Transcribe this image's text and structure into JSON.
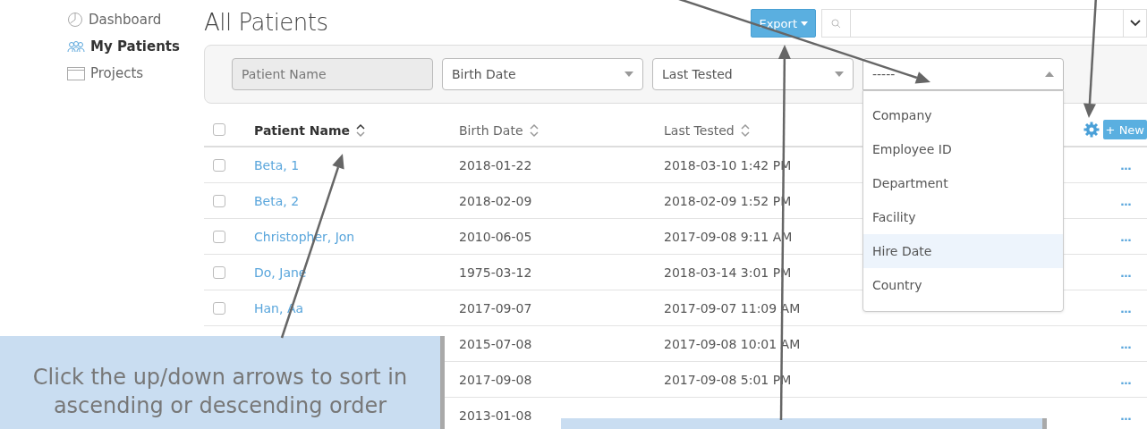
{
  "sidebar": {
    "items": [
      {
        "label": "Dashboard",
        "selected": false
      },
      {
        "label": "My Patients",
        "selected": true
      },
      {
        "label": "Projects",
        "selected": false
      }
    ]
  },
  "page_title": "All Patients",
  "export_button": {
    "label": "Export"
  },
  "filters": [
    {
      "label": "Patient Name",
      "kind": "text",
      "disabled": true
    },
    {
      "label": "Birth Date",
      "kind": "select",
      "expanded": false
    },
    {
      "label": "Last Tested",
      "kind": "select",
      "expanded": false
    },
    {
      "label": "-----",
      "kind": "select",
      "expanded": true,
      "options": [
        {
          "label": "Company",
          "selected": false
        },
        {
          "label": "Employee ID",
          "selected": false
        },
        {
          "label": "Department",
          "selected": false
        },
        {
          "label": "Facility",
          "selected": false
        },
        {
          "label": "Hire Date",
          "selected": true
        },
        {
          "label": "Country",
          "selected": false
        }
      ]
    }
  ],
  "table": {
    "select_all": {
      "checked": false
    },
    "columns": [
      {
        "label": "Patient Name",
        "sorted": true
      },
      {
        "label": "Birth Date",
        "sorted": false
      },
      {
        "label": "Last Tested",
        "sorted": false
      }
    ],
    "new_button": {
      "label": "+ New"
    },
    "rows": [
      {
        "checked": false,
        "name": "Beta, 1",
        "birth_date": "2018-01-22",
        "last_tested": "2018-03-10 1:42 PM",
        "menu": "..."
      },
      {
        "checked": false,
        "name": "Beta, 2",
        "birth_date": "2018-02-09",
        "last_tested": "2018-02-09 1:52 PM",
        "menu": "..."
      },
      {
        "checked": false,
        "name": "Christopher, Jon",
        "birth_date": "2010-06-05",
        "last_tested": "2017-09-08 9:11 AM",
        "menu": "..."
      },
      {
        "checked": false,
        "name": "Do, Jane",
        "birth_date": "1975-03-12",
        "last_tested": "2018-03-14 3:01 PM",
        "menu": "..."
      },
      {
        "checked": false,
        "name": "Han, Aa",
        "birth_date": "2017-09-07",
        "last_tested": "2017-09-07 11:09 AM",
        "menu": "..."
      },
      {
        "birth_date": "2015-07-08",
        "last_tested": "2017-09-08 10:01 AM",
        "menu": "..."
      },
      {
        "birth_date": "2017-09-08",
        "last_tested": "2017-09-08 5:01 PM",
        "menu": "..."
      },
      {
        "birth_date": "2013-01-08",
        "menu": "..."
      }
    ]
  },
  "callouts": [
    {
      "kind": "text",
      "text": "Click the up/down arrows to sort in ascending or descending order"
    },
    {
      "kind": "blank"
    }
  ]
}
